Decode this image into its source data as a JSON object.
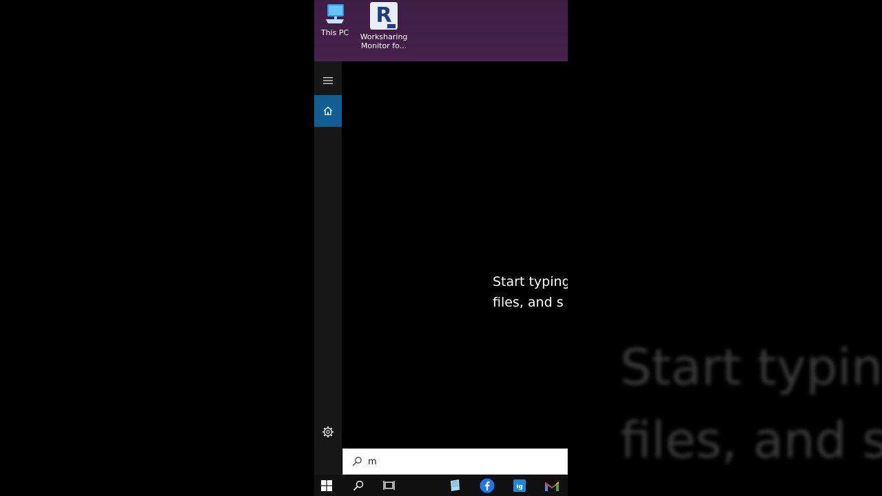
{
  "background": {
    "zoom_line1": "Start typing",
    "zoom_line2": "files, and s"
  },
  "desktop": {
    "icons": [
      {
        "label": "This PC",
        "icon": "computer-monitor-icon"
      },
      {
        "label": "Worksharing Monitor fo...",
        "icon": "revit-r-icon",
        "line1": "Worksharing",
        "line2": "Monitor fo..."
      }
    ]
  },
  "start_menu": {
    "hint_line1": "Start typing",
    "hint_line2": "files, and s",
    "rail": [
      "menu-icon",
      "home-icon",
      "gear-icon"
    ]
  },
  "search": {
    "value": "m",
    "icon": "search-icon"
  },
  "taskbar": {
    "items": [
      "windows-start-icon",
      "search-icon",
      "task-view-icon",
      "notepad-icon",
      "facebook-icon",
      "ig-app-icon",
      "gmail-icon"
    ]
  },
  "colors": {
    "desktop_bg": "#3e1d45",
    "accent": "#0f5e94",
    "rail_bg": "#171717",
    "taskbar_bg": "#101010"
  }
}
